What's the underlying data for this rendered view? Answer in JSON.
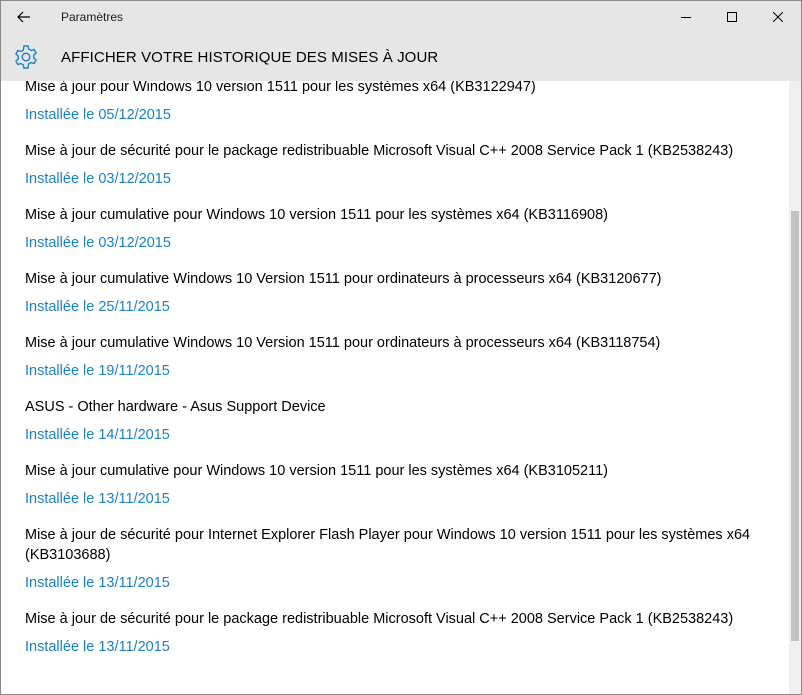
{
  "window": {
    "app_title": "Paramètres"
  },
  "header": {
    "title": "AFFICHER VOTRE HISTORIQUE DES MISES À JOUR"
  },
  "updates": [
    {
      "title": "Mise à jour pour Windows 10 version 1511 pour les systèmes x64 (KB3122947)",
      "date": "Installée le 05/12/2015"
    },
    {
      "title": "Mise à jour de sécurité pour le package redistribuable Microsoft Visual C++ 2008 Service Pack 1 (KB2538243)",
      "date": "Installée le 03/12/2015"
    },
    {
      "title": "Mise à jour cumulative pour Windows 10 version 1511 pour les systèmes x64 (KB3116908)",
      "date": "Installée le 03/12/2015"
    },
    {
      "title": "Mise à jour cumulative Windows 10 Version 1511 pour ordinateurs à processeurs x64 (KB3120677)",
      "date": "Installée le 25/11/2015"
    },
    {
      "title": "Mise à jour cumulative Windows 10 Version 1511 pour ordinateurs à processeurs x64 (KB3118754)",
      "date": "Installée le 19/11/2015"
    },
    {
      "title": "ASUS - Other hardware - Asus Support Device",
      "date": "Installée le 14/11/2015"
    },
    {
      "title": "Mise à jour cumulative pour Windows 10 version 1511 pour les systèmes x64 (KB3105211)",
      "date": "Installée le 13/11/2015"
    },
    {
      "title": "Mise à jour de sécurité pour Internet Explorer Flash Player pour Windows 10 version 1511 pour les systèmes x64 (KB3103688)",
      "date": "Installée le 13/11/2015"
    },
    {
      "title": "Mise à jour de sécurité pour le package redistribuable Microsoft Visual C++ 2008 Service Pack 1 (KB2538243)",
      "date": "Installée le 13/11/2015"
    }
  ],
  "icons": {
    "back": "back-arrow-icon",
    "settings": "gear-icon",
    "minimize": "minimize-icon",
    "maximize": "maximize-icon",
    "close": "close-icon"
  },
  "colors": {
    "accent": "#1a80c7",
    "header_bg": "#e6e6e6"
  }
}
